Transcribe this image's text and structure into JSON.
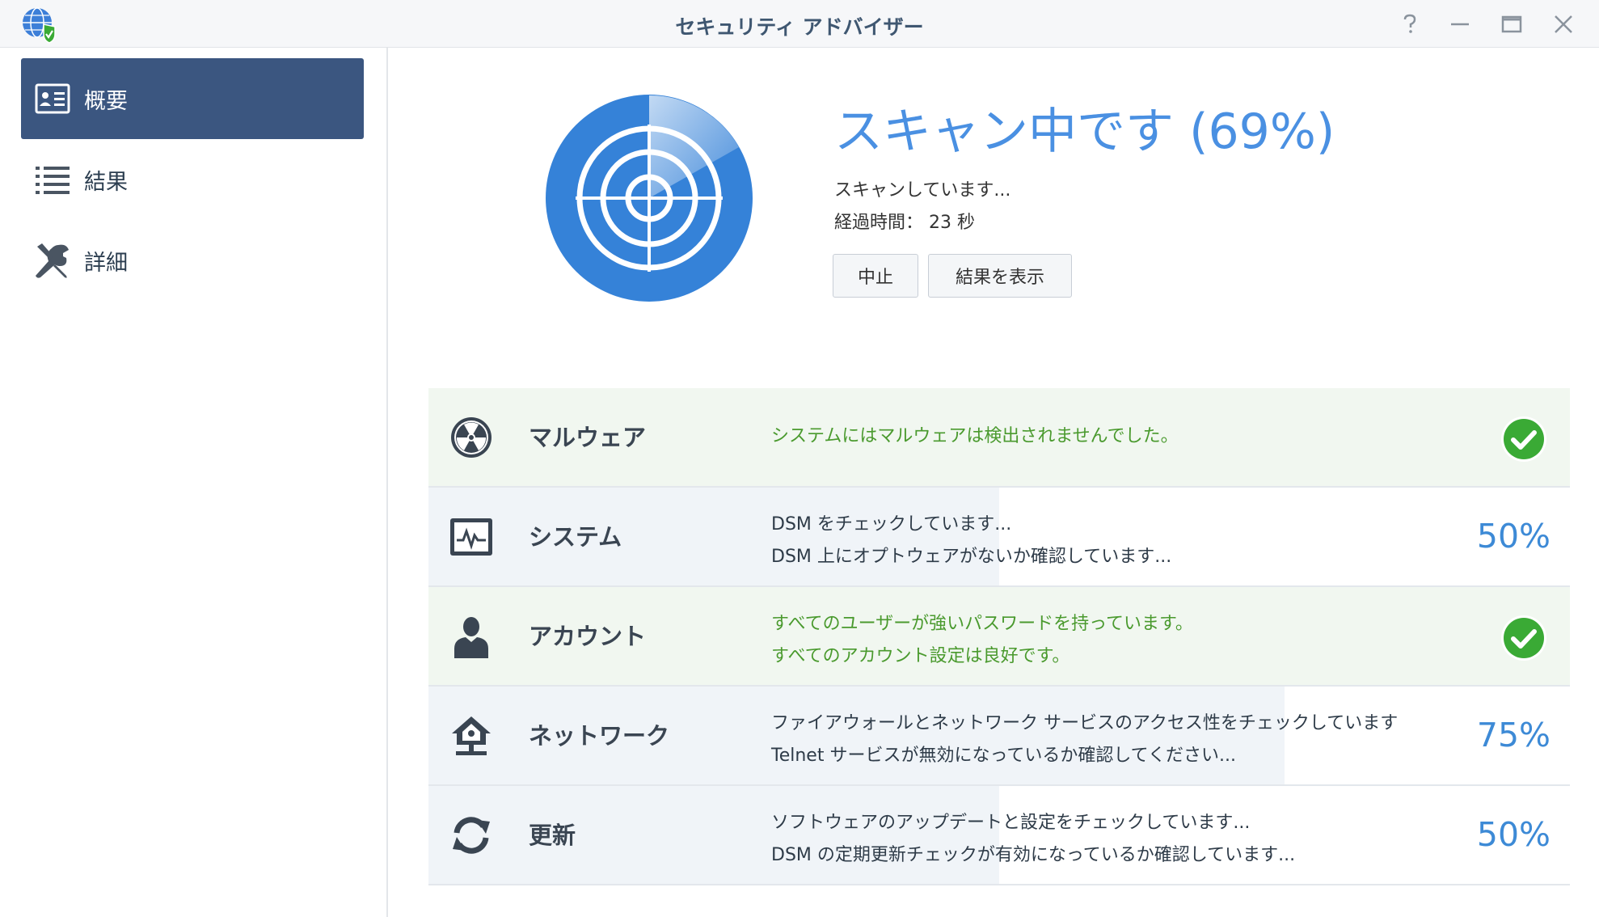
{
  "window": {
    "title": "セキュリティ アドバイザー",
    "controls": [
      "help-icon",
      "minimize-icon",
      "maximize-icon",
      "close-icon"
    ]
  },
  "sidebar": {
    "items": [
      {
        "label": "概要",
        "icon": "overview-card-icon",
        "active": true
      },
      {
        "label": "結果",
        "icon": "list-icon",
        "active": false
      },
      {
        "label": "詳細",
        "icon": "tools-icon",
        "active": false
      }
    ]
  },
  "scan": {
    "title": "スキャン中です (69%)",
    "progress_percent": 69,
    "status": "スキャンしています...",
    "elapsed": "経過時間： 23 秒",
    "stop_label": "中止",
    "results_label": "結果を表示"
  },
  "categories": [
    {
      "name": "マルウェア",
      "icon": "radiation-icon",
      "state": "done",
      "progress_percent": 100,
      "lines": [
        "システムにはマルウェアは検出されませんでした。"
      ]
    },
    {
      "name": "システム",
      "icon": "system-monitor-icon",
      "state": "running",
      "progress_percent": 50,
      "percent_text": "50%",
      "lines": [
        "DSM をチェックしています...",
        "DSM 上にオプトウェアがないか確認しています..."
      ]
    },
    {
      "name": "アカウント",
      "icon": "user-icon",
      "state": "done",
      "progress_percent": 100,
      "lines": [
        "すべてのユーザーが強いパスワードを持っています。",
        "すべてのアカウント設定は良好です。"
      ]
    },
    {
      "name": "ネットワーク",
      "icon": "network-home-icon",
      "state": "running",
      "progress_percent": 75,
      "percent_text": "75%",
      "lines": [
        "ファイアウォールとネットワーク サービスのアクセス性をチェックしています",
        "Telnet サービスが無効になっているか確認してください..."
      ]
    },
    {
      "name": "更新",
      "icon": "refresh-icon",
      "state": "running",
      "progress_percent": 50,
      "percent_text": "50%",
      "lines": [
        "ソフトウェアのアップデートと設定をチェックしています...",
        "DSM の定期更新チェックが有効になっているか確認しています..."
      ]
    }
  ],
  "colors": {
    "accent": "#4a90e2",
    "sidebar_active": "#3b5680",
    "ok_text": "#4a9a2e",
    "check_green": "#3aaa35",
    "percent_blue": "#3d8ad6"
  }
}
